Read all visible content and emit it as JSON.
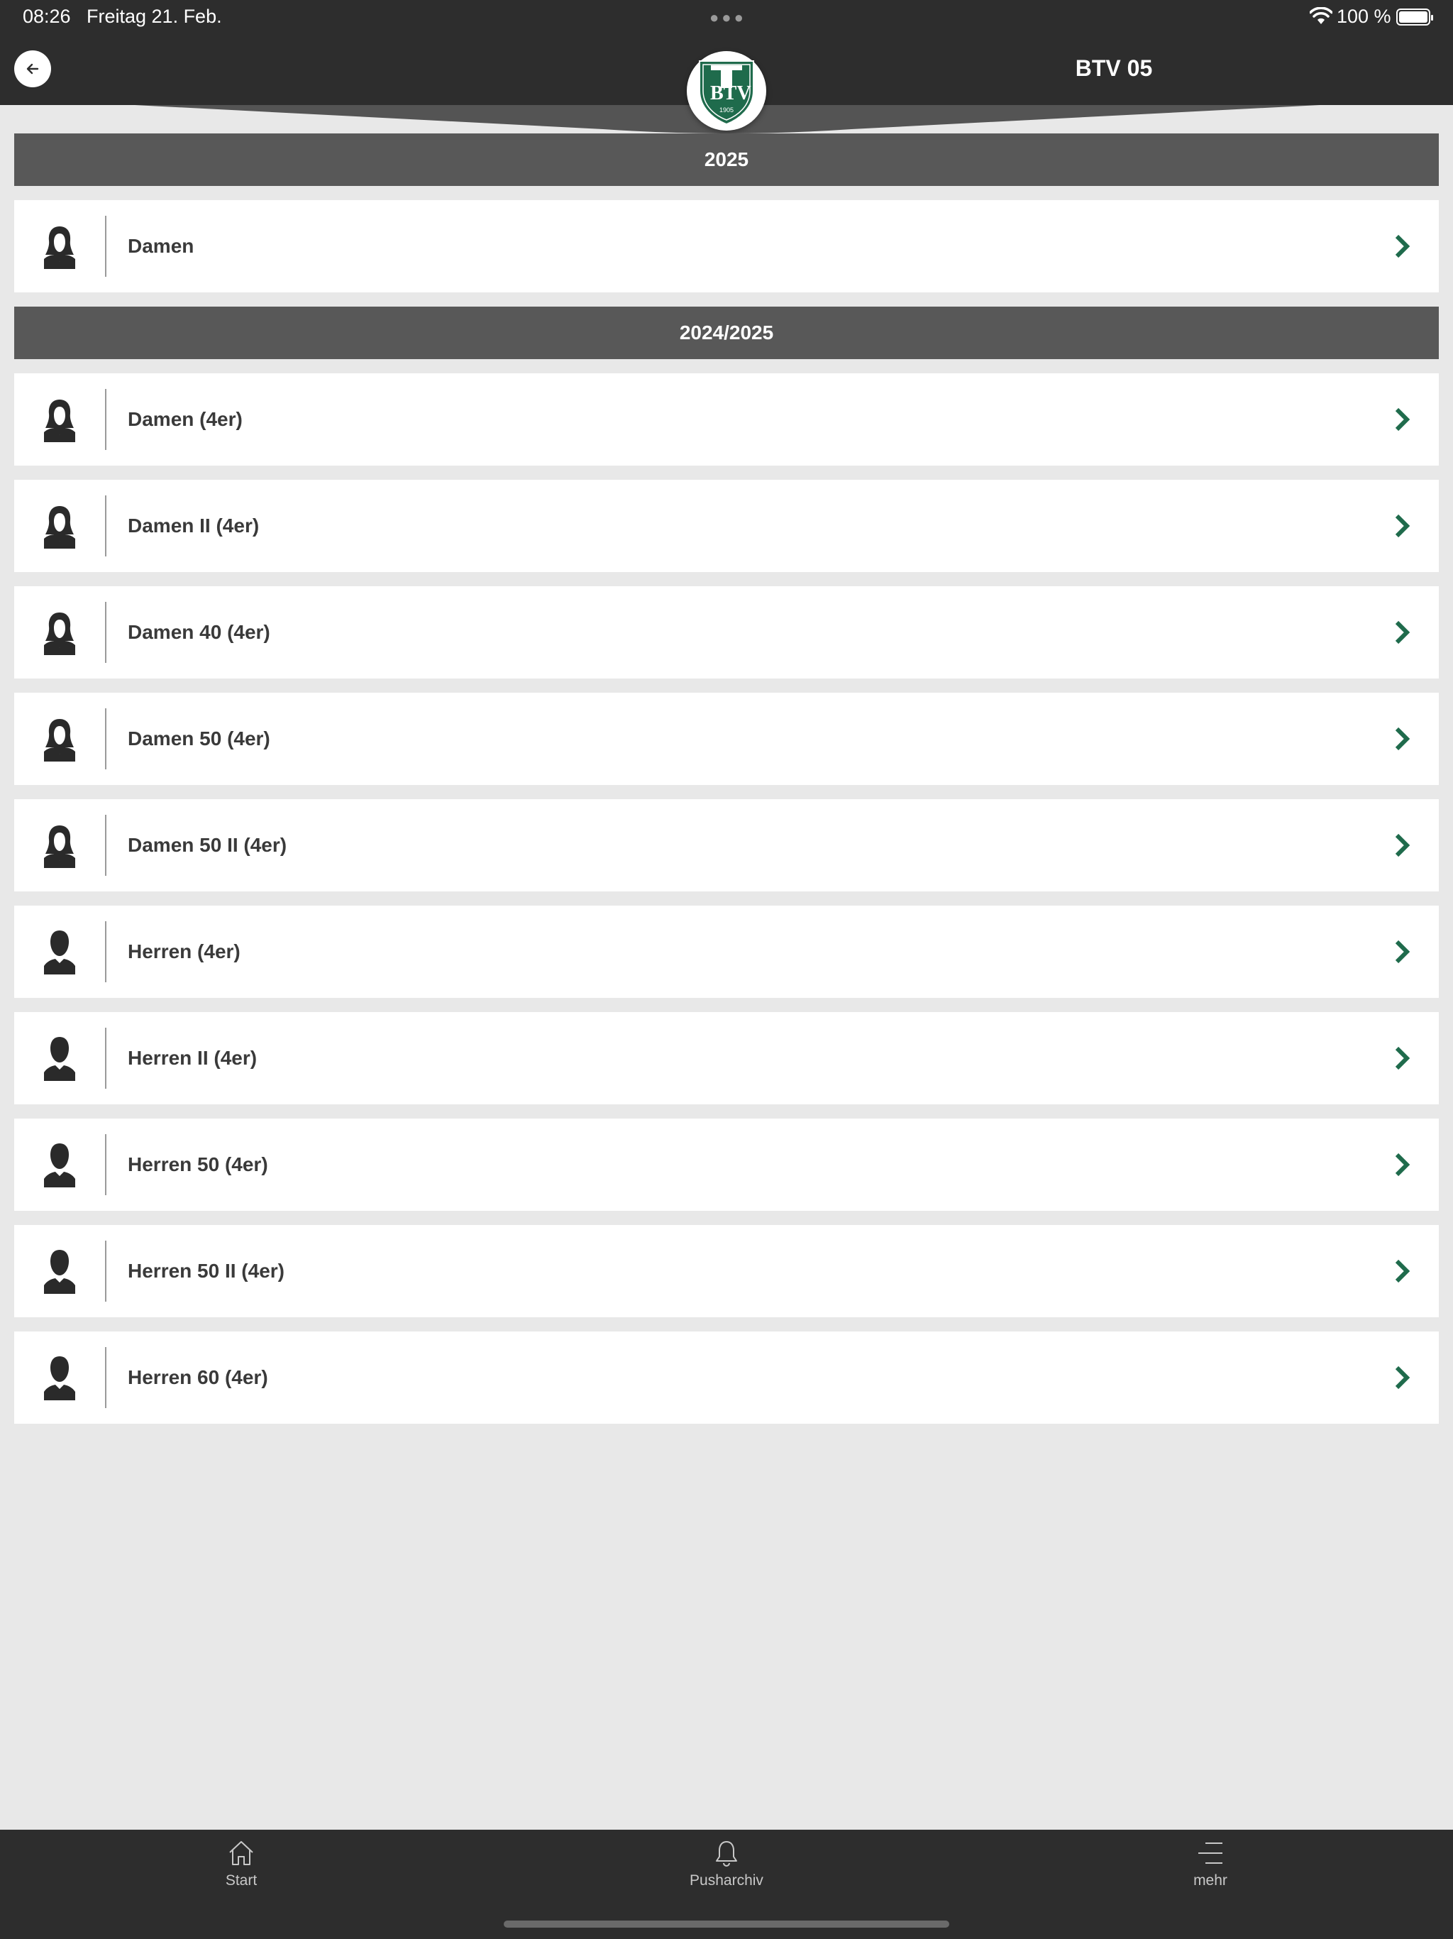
{
  "status_bar": {
    "time": "08:26",
    "date": "Freitag 21. Feb.",
    "battery": "100 %"
  },
  "header": {
    "title": "BTV 05",
    "logo_text": "BTV",
    "logo_year": "1905"
  },
  "colors": {
    "accent_green": "#1f6b4c",
    "header_bg": "#2d2d2d",
    "section_bg": "#585858",
    "page_bg": "#e8e8e8"
  },
  "sections": [
    {
      "title": "2025",
      "items": [
        {
          "label": "Damen",
          "icon": "female-person-icon"
        }
      ]
    },
    {
      "title": "2024/2025",
      "items": [
        {
          "label": "Damen (4er)",
          "icon": "female-person-icon"
        },
        {
          "label": "Damen II (4er)",
          "icon": "female-person-icon"
        },
        {
          "label": "Damen 40 (4er)",
          "icon": "female-person-icon"
        },
        {
          "label": "Damen 50 (4er)",
          "icon": "female-person-icon"
        },
        {
          "label": "Damen 50 II (4er)",
          "icon": "female-person-icon"
        },
        {
          "label": "Herren (4er)",
          "icon": "male-person-icon"
        },
        {
          "label": "Herren II (4er)",
          "icon": "male-person-icon"
        },
        {
          "label": "Herren 50 (4er)",
          "icon": "male-person-icon"
        },
        {
          "label": "Herren 50 II (4er)",
          "icon": "male-person-icon"
        },
        {
          "label": "Herren 60 (4er)",
          "icon": "male-person-icon"
        }
      ]
    }
  ],
  "tabbar": {
    "start": "Start",
    "pusharchiv": "Pusharchiv",
    "mehr": "mehr"
  }
}
